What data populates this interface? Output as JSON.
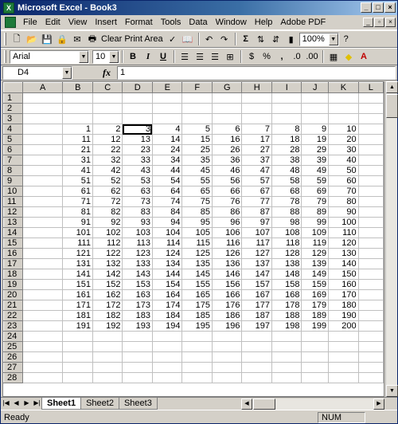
{
  "window": {
    "title": "Microsoft Excel - Book3"
  },
  "menu": {
    "items": [
      "File",
      "Edit",
      "View",
      "Insert",
      "Format",
      "Tools",
      "Data",
      "Window",
      "Help",
      "Adobe PDF"
    ]
  },
  "toolbar1": {
    "clear_print_area": "Clear Print Area",
    "sigma": "Σ",
    "zoom": "100%"
  },
  "toolbar2": {
    "font": "Arial",
    "size": "10",
    "bold": "B",
    "italic": "I",
    "underline": "U",
    "percent": "%",
    "comma": ","
  },
  "formula": {
    "cell_ref": "D4",
    "fx": "fx",
    "value": "1"
  },
  "grid": {
    "columns": [
      "A",
      "B",
      "C",
      "D",
      "E",
      "F",
      "G",
      "H",
      "I",
      "J",
      "K",
      "L"
    ],
    "row_numbers": [
      "1",
      "2",
      "3",
      "4",
      "5",
      "6",
      "7",
      "8",
      "9",
      "10",
      "11",
      "12",
      "13",
      "14",
      "15",
      "16",
      "17",
      "18",
      "19",
      "20",
      "21",
      "22",
      "23",
      "24",
      "25",
      "26",
      "27",
      "28"
    ],
    "rows": [
      [
        "",
        "",
        "",
        "",
        "",
        "",
        "",
        "",
        "",
        "",
        "",
        ""
      ],
      [
        "",
        "",
        "",
        "",
        "",
        "",
        "",
        "",
        "",
        "",
        "",
        ""
      ],
      [
        "",
        "",
        "",
        "",
        "",
        "",
        "",
        "",
        "",
        "",
        "",
        ""
      ],
      [
        "",
        "1",
        "2",
        "3",
        "4",
        "5",
        "6",
        "7",
        "8",
        "9",
        "10",
        ""
      ],
      [
        "",
        "11",
        "12",
        "13",
        "14",
        "15",
        "16",
        "17",
        "18",
        "19",
        "20",
        ""
      ],
      [
        "",
        "21",
        "22",
        "23",
        "24",
        "25",
        "26",
        "27",
        "28",
        "29",
        "30",
        ""
      ],
      [
        "",
        "31",
        "32",
        "33",
        "34",
        "35",
        "36",
        "37",
        "38",
        "39",
        "40",
        ""
      ],
      [
        "",
        "41",
        "42",
        "43",
        "44",
        "45",
        "46",
        "47",
        "48",
        "49",
        "50",
        ""
      ],
      [
        "",
        "51",
        "52",
        "53",
        "54",
        "55",
        "56",
        "57",
        "58",
        "59",
        "60",
        ""
      ],
      [
        "",
        "61",
        "62",
        "63",
        "64",
        "65",
        "66",
        "67",
        "68",
        "69",
        "70",
        ""
      ],
      [
        "",
        "71",
        "72",
        "73",
        "74",
        "75",
        "76",
        "77",
        "78",
        "79",
        "80",
        ""
      ],
      [
        "",
        "81",
        "82",
        "83",
        "84",
        "85",
        "86",
        "87",
        "88",
        "89",
        "90",
        ""
      ],
      [
        "",
        "91",
        "92",
        "93",
        "94",
        "95",
        "96",
        "97",
        "98",
        "99",
        "100",
        ""
      ],
      [
        "",
        "101",
        "102",
        "103",
        "104",
        "105",
        "106",
        "107",
        "108",
        "109",
        "110",
        ""
      ],
      [
        "",
        "111",
        "112",
        "113",
        "114",
        "115",
        "116",
        "117",
        "118",
        "119",
        "120",
        ""
      ],
      [
        "",
        "121",
        "122",
        "123",
        "124",
        "125",
        "126",
        "127",
        "128",
        "129",
        "130",
        ""
      ],
      [
        "",
        "131",
        "132",
        "133",
        "134",
        "135",
        "136",
        "137",
        "138",
        "139",
        "140",
        ""
      ],
      [
        "",
        "141",
        "142",
        "143",
        "144",
        "145",
        "146",
        "147",
        "148",
        "149",
        "150",
        ""
      ],
      [
        "",
        "151",
        "152",
        "153",
        "154",
        "155",
        "156",
        "157",
        "158",
        "159",
        "160",
        ""
      ],
      [
        "",
        "161",
        "162",
        "163",
        "164",
        "165",
        "166",
        "167",
        "168",
        "169",
        "170",
        ""
      ],
      [
        "",
        "171",
        "172",
        "173",
        "174",
        "175",
        "176",
        "177",
        "178",
        "179",
        "180",
        ""
      ],
      [
        "",
        "181",
        "182",
        "183",
        "184",
        "185",
        "186",
        "187",
        "188",
        "189",
        "190",
        ""
      ],
      [
        "",
        "191",
        "192",
        "193",
        "194",
        "195",
        "196",
        "197",
        "198",
        "199",
        "200",
        ""
      ],
      [
        "",
        "",
        "",
        "",
        "",
        "",
        "",
        "",
        "",
        "",
        "",
        ""
      ],
      [
        "",
        "",
        "",
        "",
        "",
        "",
        "",
        "",
        "",
        "",
        "",
        ""
      ],
      [
        "",
        "",
        "",
        "",
        "",
        "",
        "",
        "",
        "",
        "",
        "",
        ""
      ],
      [
        "",
        "",
        "",
        "",
        "",
        "",
        "",
        "",
        "",
        "",
        "",
        ""
      ],
      [
        "",
        "",
        "",
        "",
        "",
        "",
        "",
        "",
        "",
        "",
        "",
        ""
      ]
    ]
  },
  "sheets": [
    "Sheet1",
    "Sheet2",
    "Sheet3"
  ],
  "active_sheet": "Sheet1",
  "status": {
    "left": "Ready",
    "num": "NUM"
  }
}
